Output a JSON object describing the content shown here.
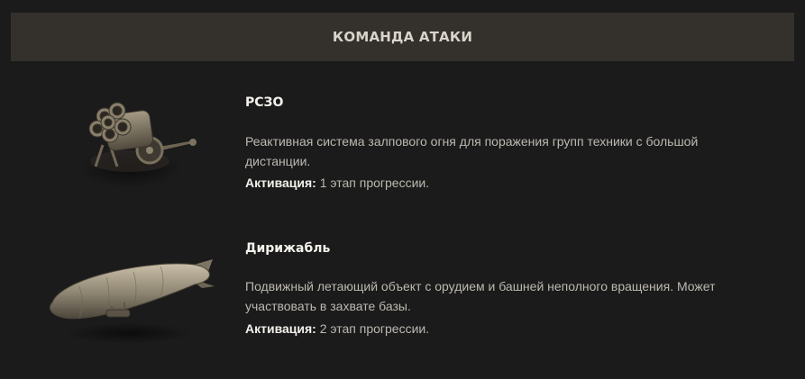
{
  "header": {
    "title": "КОМАНДА АТАКИ"
  },
  "items": [
    {
      "icon": "rocket-launcher-icon",
      "name": "РСЗО",
      "description": "Реактивная система залпового огня для поражения групп техники с большой дистанции.",
      "activation_label": "Активация:",
      "activation_value": " 1 этап прогрессии."
    },
    {
      "icon": "airship-icon",
      "name": "Дирижабль",
      "description": "Подвижный летающий объект с орудием и башней неполного вращения. Может участвовать в захвате базы.",
      "activation_label": "Активация:",
      "activation_value": " 2 этап прогрессии."
    }
  ]
}
